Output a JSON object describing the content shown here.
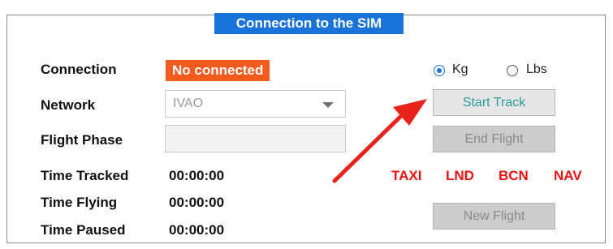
{
  "panel": {
    "title": "Connection to the SIM"
  },
  "connection": {
    "label": "Connection",
    "status": "No connected",
    "status_color": "#f25a1e"
  },
  "network": {
    "label": "Network",
    "selected": "IVAO"
  },
  "flight_phase": {
    "label": "Flight Phase",
    "value": ""
  },
  "times": [
    {
      "label": "Time Tracked",
      "value": "00:00:00"
    },
    {
      "label": "Time Flying",
      "value": "00:00:00"
    },
    {
      "label": "Time Paused",
      "value": "00:00:00"
    }
  ],
  "units": {
    "kg_label": "Kg",
    "lbs_label": "Lbs",
    "selected": "Kg"
  },
  "buttons": {
    "start_track": "Start Track",
    "end_flight": "End Flight",
    "new_flight": "New Flight"
  },
  "phase_tags": [
    "TAXI",
    "LND",
    "BCN",
    "NAV"
  ],
  "colors": {
    "accent": "#1a73d8",
    "tag_red": "#ee1111",
    "arrow_red": "#e8231c"
  }
}
